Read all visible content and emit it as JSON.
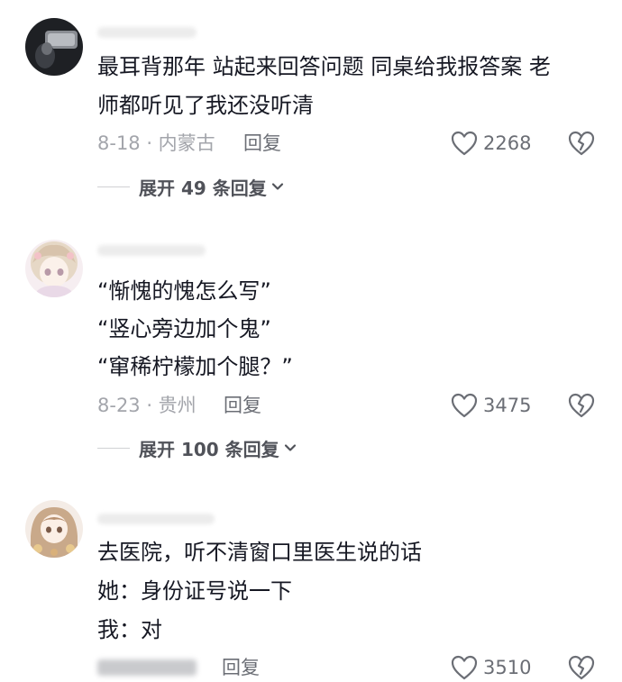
{
  "comments": [
    {
      "lines": [
        "最耳背那年 站起来回答问题 同桌给我报答案 老",
        "师都听见了我还没听清"
      ],
      "meta": "8-18 · 内蒙古",
      "reply": "回复",
      "likes": "2268",
      "expand": "展开 49 条回复"
    },
    {
      "lines": [
        "“惭愧的愧怎么写”",
        "“竖心旁边加个鬼”",
        "“窜稀柠檬加个腿？”"
      ],
      "meta": "8-23 · 贵州",
      "reply": "回复",
      "likes": "3475",
      "expand": "展开 100 条回复"
    },
    {
      "lines": [
        "去医院，听不清窗口里医生说的话",
        "她：身份证号说一下",
        "我：对"
      ],
      "reply": "回复",
      "likes": "3510"
    }
  ],
  "colors": {
    "text": "#161823",
    "meta": "#a3a5ab",
    "secondary": "#6b6e75"
  },
  "icons": {
    "like": "heart-outline-icon",
    "dislike": "broken-heart-icon",
    "expand": "chevron-down-icon"
  }
}
